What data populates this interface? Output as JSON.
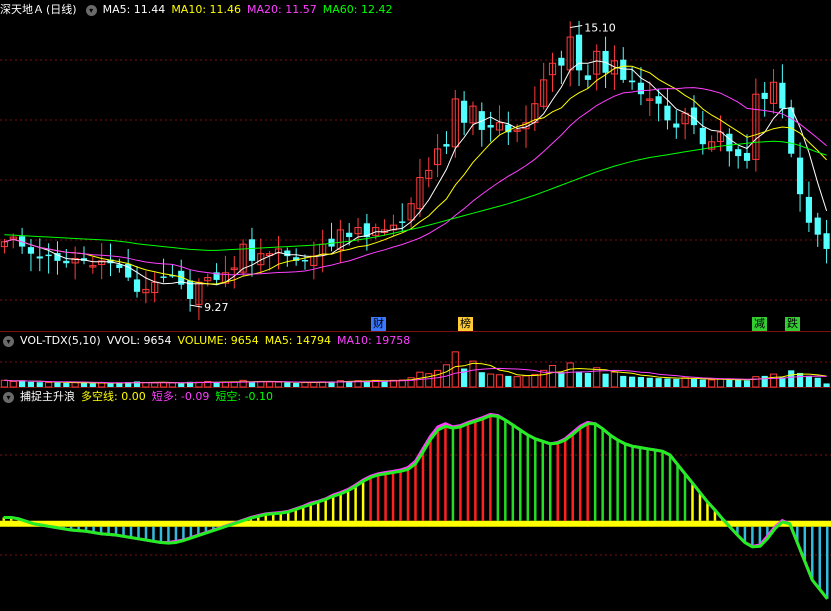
{
  "colors": {
    "up": "#ff3b3b",
    "down": "#54ffff",
    "ma5": "#ffffff",
    "ma10": "#ffff00",
    "ma20": "#ff40ff",
    "ma60": "#00ff00",
    "bg": "#000000",
    "grid": "#7a1010"
  },
  "price_panel": {
    "title": "深天地Ａ",
    "period": "(日线)",
    "ma5_label": "MA5: 11.44",
    "ma10_label": "MA10: 11.46",
    "ma20_label": "MA20: 11.57",
    "ma60_label": "MA60: 12.42",
    "high_marker": "15.10",
    "low_marker": "9.27"
  },
  "events": [
    {
      "label": "财",
      "color": "#3a78ff"
    },
    {
      "label": "榜",
      "color": "#ffcc33"
    },
    {
      "label": "减",
      "color": "#33cc33"
    },
    {
      "label": "跌",
      "color": "#33cc33"
    }
  ],
  "volume_panel": {
    "title": "VOL-TDX(5,10)",
    "vvol_label": "VVOL: 9654",
    "volume_label": "VOLUME: 9654",
    "ma5_label": "MA5: 14794",
    "ma10_label": "MA10: 19758"
  },
  "indicator_panel": {
    "title": "捕捉主升浪",
    "duokong_label": "多空线: 0.00",
    "duanduo_label": "短多: -0.09",
    "duankong_label": "短空: -0.10"
  },
  "chart_data": [
    {
      "type": "candlestick",
      "price_range": [
        9.0,
        15.3
      ],
      "close": [
        10.6,
        10.7,
        10.5,
        10.35,
        10.25,
        10.3,
        10.2,
        10.15,
        10.25,
        10.2,
        10.1,
        10.2,
        10.15,
        10.05,
        9.85,
        9.55,
        9.6,
        9.75,
        9.85,
        9.9,
        9.7,
        9.4,
        9.75,
        9.85,
        9.8,
        9.95,
        10.05,
        10.55,
        10.2,
        10.35,
        10.35,
        10.45,
        10.3,
        10.2,
        10.2,
        10.3,
        10.55,
        10.5,
        10.85,
        10.7,
        10.9,
        10.7,
        10.9,
        10.85,
        10.95,
        11.0,
        11.4,
        11.95,
        12.1,
        12.55,
        12.6,
        13.6,
        13.1,
        13.45,
        12.95,
        13.0,
        13.1,
        12.9,
        12.95,
        13.1,
        13.5,
        14.0,
        14.35,
        14.3,
        14.9,
        14.2,
        14.0,
        14.6,
        14.15,
        14.4,
        14.0,
        13.95,
        13.7,
        13.6,
        13.5,
        13.15,
        13.0,
        13.3,
        13.05,
        12.65,
        12.7,
        12.9,
        12.5,
        12.4,
        12.3,
        13.7,
        13.6,
        13.95,
        13.4,
        12.45,
        11.6,
        11.0,
        10.75,
        10.45
      ],
      "ma60": [
        10.75,
        10.74,
        10.73,
        10.72,
        10.71,
        10.7,
        10.69,
        10.68,
        10.67,
        10.66,
        10.65,
        10.64,
        10.63,
        10.61,
        10.59,
        10.56,
        10.54,
        10.52,
        10.5,
        10.48,
        10.46,
        10.44,
        10.43,
        10.42,
        10.42,
        10.43,
        10.44,
        10.45,
        10.46,
        10.47,
        10.48,
        10.49,
        10.5,
        10.51,
        10.52,
        10.53,
        10.55,
        10.57,
        10.59,
        10.61,
        10.64,
        10.67,
        10.7,
        10.74,
        10.78,
        10.82,
        10.86,
        10.9,
        10.95,
        11.0,
        11.05,
        11.1,
        11.15,
        11.2,
        11.25,
        11.3,
        11.35,
        11.4,
        11.46,
        11.52,
        11.58,
        11.65,
        11.72,
        11.79,
        11.86,
        11.93,
        12.0,
        12.07,
        12.13,
        12.19,
        12.24,
        12.29,
        12.33,
        12.37,
        12.4,
        12.43,
        12.46,
        12.49,
        12.52,
        12.55,
        12.58,
        12.61,
        12.63,
        12.65,
        12.67,
        12.69,
        12.7,
        12.71,
        12.7,
        12.67,
        12.62,
        12.55,
        12.48,
        12.42
      ]
    },
    {
      "type": "bar",
      "series": [
        {
          "name": "VOLUME",
          "values": [
            18000,
            15000,
            17000,
            14000,
            13000,
            12000,
            12000,
            11000,
            12000,
            11000,
            10000,
            11000,
            10000,
            11000,
            13000,
            15000,
            12000,
            11000,
            12000,
            11000,
            10000,
            14000,
            13000,
            15000,
            12000,
            13000,
            14000,
            18000,
            14000,
            15000,
            14000,
            13000,
            12000,
            11000,
            12000,
            13000,
            14000,
            15000,
            17000,
            16000,
            17000,
            16000,
            18000,
            17000,
            18000,
            19000,
            25000,
            40000,
            36000,
            45000,
            60000,
            95000,
            50000,
            70000,
            40000,
            35000,
            33000,
            30000,
            28000,
            30000,
            34000,
            45000,
            58000,
            40000,
            65000,
            42000,
            38000,
            52000,
            36000,
            40000,
            30000,
            28000,
            27000,
            25000,
            24000,
            23000,
            22000,
            25000,
            22000,
            20000,
            19000,
            21000,
            20000,
            19000,
            18000,
            28000,
            30000,
            35000,
            26000,
            45000,
            38000,
            30000,
            25000,
            9654
          ]
        }
      ]
    },
    {
      "type": "bar",
      "series": [
        {
          "name": "多空线",
          "values": [
            0.0
          ]
        },
        {
          "name": "短多",
          "values": [
            0.1,
            0.1,
            0.08,
            0.04,
            0.0,
            -0.02,
            -0.04,
            -0.06,
            -0.08,
            -0.1,
            -0.11,
            -0.12,
            -0.14,
            -0.16,
            -0.17,
            -0.18,
            -0.2,
            -0.22,
            -0.24,
            -0.26,
            -0.28,
            -0.3,
            -0.3,
            -0.28,
            -0.26,
            -0.22,
            -0.18,
            -0.14,
            -0.1,
            -0.06,
            -0.02,
            0.02,
            0.06,
            0.1,
            0.13,
            0.16,
            0.17,
            0.18,
            0.2,
            0.24,
            0.28,
            0.33,
            0.36,
            0.4,
            0.46,
            0.5,
            0.55,
            0.62,
            0.7,
            0.76,
            0.8,
            0.82,
            0.84,
            0.86,
            0.9,
            1.0,
            1.2,
            1.4,
            1.55,
            1.6,
            1.55,
            1.57,
            1.62,
            1.66,
            1.7,
            1.75,
            1.73,
            1.66,
            1.58,
            1.5,
            1.42,
            1.36,
            1.32,
            1.28,
            1.3,
            1.36,
            1.46,
            1.56,
            1.62,
            1.6,
            1.52,
            1.42,
            1.34,
            1.28,
            1.24,
            1.22,
            1.2,
            1.18,
            1.16,
            1.1,
            0.95,
            0.8,
            0.65,
            0.5,
            0.35,
            0.22,
            0.08,
            -0.05,
            -0.18,
            -0.3,
            -0.36,
            -0.34,
            -0.2,
            -0.05,
            0.05,
            0.0,
            -0.3,
            -0.6,
            -0.9,
            -1.05,
            -1.2
          ]
        },
        {
          "name": "短空",
          "values": [
            0.1,
            0.1,
            0.08,
            0.04,
            0.0,
            -0.02,
            -0.04,
            -0.06,
            -0.08,
            -0.1,
            -0.11,
            -0.12,
            -0.14,
            -0.16,
            -0.17,
            -0.18,
            -0.2,
            -0.22,
            -0.24,
            -0.26,
            -0.28,
            -0.3,
            -0.31,
            -0.3,
            -0.27,
            -0.23,
            -0.19,
            -0.15,
            -0.11,
            -0.07,
            -0.03,
            0.01,
            0.05,
            0.09,
            0.12,
            0.15,
            0.16,
            0.17,
            0.19,
            0.23,
            0.27,
            0.31,
            0.35,
            0.39,
            0.44,
            0.48,
            0.53,
            0.6,
            0.68,
            0.74,
            0.78,
            0.8,
            0.82,
            0.84,
            0.87,
            0.96,
            1.15,
            1.35,
            1.5,
            1.56,
            1.53,
            1.55,
            1.6,
            1.64,
            1.68,
            1.73,
            1.72,
            1.66,
            1.58,
            1.5,
            1.42,
            1.36,
            1.32,
            1.28,
            1.29,
            1.34,
            1.43,
            1.53,
            1.6,
            1.6,
            1.52,
            1.42,
            1.34,
            1.28,
            1.24,
            1.22,
            1.2,
            1.18,
            1.16,
            1.1,
            0.95,
            0.8,
            0.65,
            0.5,
            0.35,
            0.22,
            0.08,
            -0.05,
            -0.18,
            -0.3,
            -0.37,
            -0.36,
            -0.24,
            -0.08,
            0.03,
            0.0,
            -0.3,
            -0.6,
            -0.9,
            -1.05,
            -1.2
          ]
        }
      ]
    }
  ]
}
